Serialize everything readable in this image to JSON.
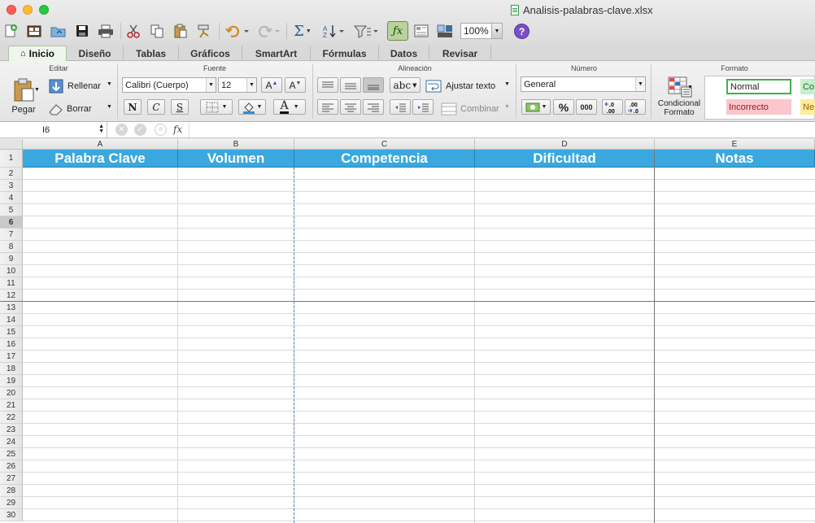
{
  "window": {
    "title": "Analisis-palabras-clave.xlsx"
  },
  "toolbar": {
    "zoom": "100%"
  },
  "tabs": [
    "Inicio",
    "Diseño",
    "Tablas",
    "Gráficos",
    "SmartArt",
    "Fórmulas",
    "Datos",
    "Revisar"
  ],
  "ribbon": {
    "groups": {
      "editar": "Editar",
      "fuente": "Fuente",
      "alineacion": "Alineación",
      "numero": "Número",
      "formato": "Formato"
    },
    "pegar": "Pegar",
    "rellenar": "Rellenar",
    "borrar": "Borrar",
    "font_name": "Calibri (Cuerpo)",
    "font_size": "12",
    "bold": "N",
    "italic": "C",
    "underline": "S",
    "wrap": "Ajustar texto",
    "merge": "Combinar",
    "abc": "abc",
    "number_format": "General",
    "percent": "%",
    "thousands": "000",
    "dec_inc": "←.0\n.00",
    "dec_dec": ".00\n→.0",
    "cond_format_1": "Condicional",
    "cond_format_2": "Formato",
    "styles": {
      "normal": "Normal",
      "bad": "Incorrecto",
      "good": "Co",
      "neutral": "Ne"
    }
  },
  "formula_bar": {
    "name_box": "I6",
    "fx": "fx",
    "content": ""
  },
  "sheet": {
    "columns": [
      "A",
      "B",
      "C",
      "D",
      "E"
    ],
    "headers": [
      "Palabra Clave",
      "Volumen",
      "Competencia",
      "Dificultad",
      "Notas"
    ],
    "rows": [
      "1",
      "2",
      "3",
      "4",
      "5",
      "6",
      "7",
      "8",
      "9",
      "10",
      "11",
      "12",
      "13",
      "14",
      "15",
      "16",
      "17",
      "18",
      "19",
      "20",
      "21",
      "22",
      "23",
      "24",
      "25",
      "26",
      "27",
      "28",
      "29",
      "30"
    ],
    "selected_row": "6",
    "header_color": "#3aa8df"
  }
}
